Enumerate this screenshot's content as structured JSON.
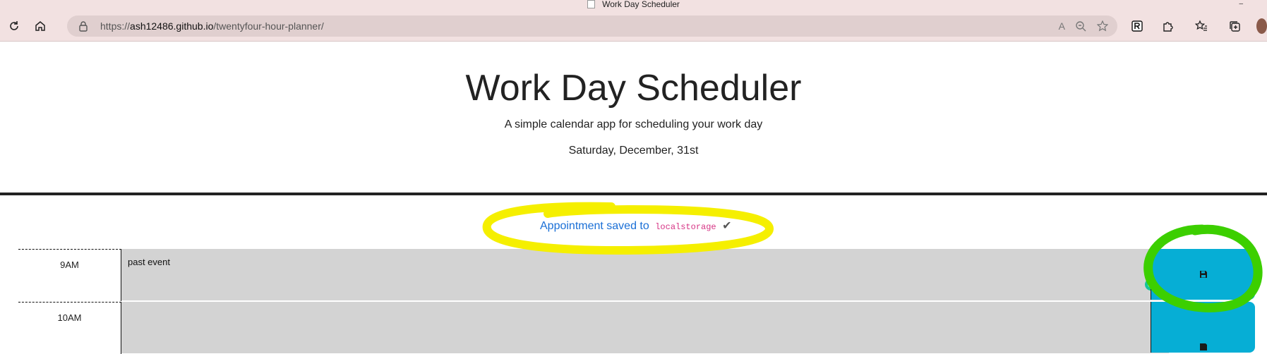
{
  "browser": {
    "window_title": "Work Day Scheduler",
    "minimize_glyph": "–",
    "url_prefix": "https://",
    "url_host": "ash12486.github.io",
    "url_path": "/twentyfour-hour-planner/"
  },
  "header": {
    "title": "Work Day Scheduler",
    "lead": "A simple calendar app for scheduling your work day",
    "current_day": "Saturday, December, 31st"
  },
  "notice": {
    "text": "Appointment saved to",
    "code": "localstorage",
    "check": "✔"
  },
  "time_blocks": [
    {
      "hour": "9AM",
      "event": "past event"
    },
    {
      "hour": "10AM",
      "event": ""
    }
  ],
  "colors": {
    "past": "#d3d3d3",
    "save_button": "#06aed5",
    "highlight_yellow": "#f5ef00",
    "highlight_green": "#3ccf00"
  },
  "icons": {
    "save": "floppy-disk-icon",
    "grammarly": "grammarly-icon"
  }
}
